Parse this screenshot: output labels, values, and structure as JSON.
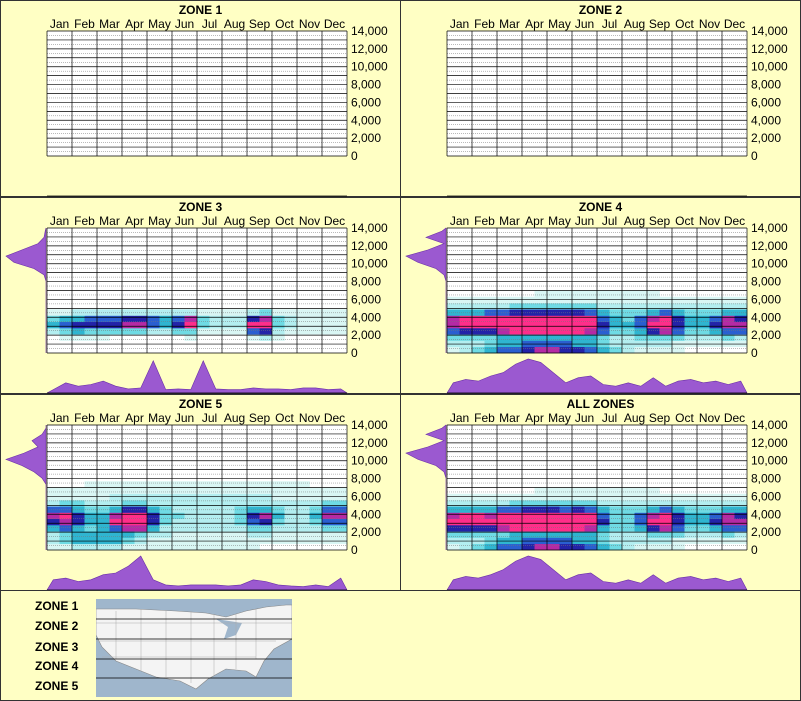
{
  "months": [
    "Jan",
    "Feb",
    "Mar",
    "Apr",
    "May",
    "Jun",
    "Jul",
    "Aug",
    "Sep",
    "Oct",
    "Nov",
    "Dec"
  ],
  "y_ticks": [
    "14,000",
    "12,000",
    "10,000",
    "8,000",
    "6,000",
    "4,000",
    "2,000",
    "0"
  ],
  "colors": {
    "background": "#ffffc4",
    "profile": "#9b59d0",
    "low": "#c8f0f0",
    "mid": "#3ec6d6",
    "high": "#1a1aa8",
    "peak": "#ff2e8a"
  },
  "legend": {
    "zones": [
      "ZONE 1",
      "ZONE 2",
      "ZONE 3",
      "ZONE 4",
      "ZONE 5"
    ]
  },
  "chart_data": [
    {
      "type": "heatmap",
      "title": "ZONE 1",
      "x": [
        "Jan",
        "Feb",
        "Mar",
        "Apr",
        "May",
        "Jun",
        "Jul",
        "Aug",
        "Sep",
        "Oct",
        "Nov",
        "Dec"
      ],
      "ylim": [
        0,
        14000
      ],
      "blobs": [],
      "monthly_profile": [],
      "elevation_profile": []
    },
    {
      "type": "heatmap",
      "title": "ZONE 2",
      "x": [
        "Jan",
        "Feb",
        "Mar",
        "Apr",
        "May",
        "Jun",
        "Jul",
        "Aug",
        "Sep",
        "Oct",
        "Nov",
        "Dec"
      ],
      "ylim": [
        0,
        14000
      ],
      "blobs": [],
      "monthly_profile": [],
      "elevation_profile": []
    },
    {
      "type": "heatmap",
      "title": "ZONE 3",
      "x": [
        "Jan",
        "Feb",
        "Mar",
        "Apr",
        "May",
        "Jun",
        "Jul",
        "Aug",
        "Sep",
        "Oct",
        "Nov",
        "Dec"
      ],
      "ylim": [
        0,
        14000
      ],
      "blobs": [
        {
          "month": 1.2,
          "elev": 3200,
          "sm": 0.9,
          "se": 700,
          "w": 0.7
        },
        {
          "month": 3.5,
          "elev": 3400,
          "sm": 0.9,
          "se": 600,
          "w": 0.8
        },
        {
          "month": 5.6,
          "elev": 3400,
          "sm": 0.3,
          "se": 600,
          "w": 1.0
        },
        {
          "month": 8.6,
          "elev": 3200,
          "sm": 0.35,
          "se": 700,
          "w": 1.4
        },
        {
          "month": 6.5,
          "elev": 3500,
          "sm": 4.5,
          "se": 1000,
          "w": 0.25
        }
      ],
      "monthly_profile": [
        0.1,
        0.3,
        0.2,
        0.25,
        0.35,
        0.2,
        0.12,
        0.15,
        0.95,
        0.1,
        0.12,
        0.1,
        0.95,
        0.12,
        0.1,
        0.1,
        0.15,
        0.12,
        0.12,
        0.1,
        0.15,
        0.15,
        0.1,
        0.12
      ],
      "elevation_profile": [
        0,
        0,
        0,
        0,
        0,
        0,
        0,
        0,
        0,
        0,
        0,
        0,
        0.05,
        0.3,
        0.8,
        1.0,
        0.6,
        0.2,
        0.05,
        0.02
      ]
    },
    {
      "type": "heatmap",
      "title": "ZONE 4",
      "x": [
        "Jan",
        "Feb",
        "Mar",
        "Apr",
        "May",
        "Jun",
        "Jul",
        "Aug",
        "Sep",
        "Oct",
        "Nov",
        "Dec"
      ],
      "ylim": [
        0,
        14000
      ],
      "blobs": [
        {
          "month": 3.5,
          "elev": 3300,
          "sm": 1.4,
          "se": 900,
          "w": 1.5
        },
        {
          "month": 0.6,
          "elev": 3300,
          "sm": 0.8,
          "se": 900,
          "w": 0.8
        },
        {
          "month": 5.5,
          "elev": 3300,
          "sm": 0.5,
          "se": 900,
          "w": 0.8
        },
        {
          "month": 8.6,
          "elev": 3300,
          "sm": 0.6,
          "se": 900,
          "w": 1.0
        },
        {
          "month": 11.4,
          "elev": 3300,
          "sm": 0.7,
          "se": 900,
          "w": 0.8
        },
        {
          "month": 4.0,
          "elev": 500,
          "sm": 1.8,
          "se": 500,
          "w": 0.9
        },
        {
          "month": 6.0,
          "elev": 3500,
          "sm": 6.0,
          "se": 1800,
          "w": 0.35
        }
      ],
      "monthly_profile": [
        0.3,
        0.4,
        0.35,
        0.5,
        0.6,
        0.85,
        1.0,
        0.9,
        0.6,
        0.3,
        0.45,
        0.5,
        0.25,
        0.2,
        0.3,
        0.2,
        0.45,
        0.2,
        0.35,
        0.4,
        0.3,
        0.35,
        0.25,
        0.35
      ],
      "elevation_profile": [
        0,
        0,
        0,
        0,
        0,
        0,
        0,
        0,
        0,
        0,
        0,
        0,
        0.05,
        0.25,
        0.7,
        1.0,
        0.45,
        0.05,
        0.5,
        0.1
      ]
    },
    {
      "type": "heatmap",
      "title": "ZONE 5",
      "x": [
        "Jan",
        "Feb",
        "Mar",
        "Apr",
        "May",
        "Jun",
        "Jul",
        "Aug",
        "Sep",
        "Oct",
        "Nov",
        "Dec"
      ],
      "ylim": [
        0,
        14000
      ],
      "blobs": [
        {
          "month": 3.4,
          "elev": 3400,
          "sm": 0.6,
          "se": 800,
          "w": 1.6
        },
        {
          "month": 0.7,
          "elev": 3600,
          "sm": 0.7,
          "se": 900,
          "w": 0.9
        },
        {
          "month": 8.6,
          "elev": 3600,
          "sm": 0.4,
          "se": 700,
          "w": 0.8
        },
        {
          "month": 11.5,
          "elev": 3800,
          "sm": 0.5,
          "se": 900,
          "w": 0.8
        },
        {
          "month": 2.0,
          "elev": 1200,
          "sm": 1.0,
          "se": 700,
          "w": 0.5
        },
        {
          "month": 6.0,
          "elev": 4000,
          "sm": 6.0,
          "se": 2200,
          "w": 0.3
        }
      ],
      "monthly_profile": [
        0.3,
        0.35,
        0.25,
        0.3,
        0.45,
        0.5,
        0.7,
        1.0,
        0.3,
        0.15,
        0.12,
        0.15,
        0.15,
        0.15,
        0.12,
        0.15,
        0.3,
        0.25,
        0.15,
        0.12,
        0.1,
        0.15,
        0.1,
        0.35
      ],
      "elevation_profile": [
        0,
        0,
        0,
        0,
        0,
        0,
        0,
        0,
        0,
        0,
        0,
        0.1,
        0.3,
        0.6,
        1.0,
        0.55,
        0.2,
        0.35,
        0.1,
        0
      ]
    },
    {
      "type": "heatmap",
      "title": "ALL ZONES",
      "x": [
        "Jan",
        "Feb",
        "Mar",
        "Apr",
        "May",
        "Jun",
        "Jul",
        "Aug",
        "Sep",
        "Oct",
        "Nov",
        "Dec"
      ],
      "ylim": [
        0,
        14000
      ],
      "blobs": [
        {
          "month": 3.5,
          "elev": 3300,
          "sm": 1.3,
          "se": 900,
          "w": 1.5
        },
        {
          "month": 0.6,
          "elev": 3300,
          "sm": 0.8,
          "se": 900,
          "w": 0.9
        },
        {
          "month": 5.5,
          "elev": 3300,
          "sm": 0.5,
          "se": 900,
          "w": 0.8
        },
        {
          "month": 8.6,
          "elev": 3300,
          "sm": 0.6,
          "se": 900,
          "w": 1.0
        },
        {
          "month": 11.4,
          "elev": 3300,
          "sm": 0.7,
          "se": 900,
          "w": 0.8
        },
        {
          "month": 4.0,
          "elev": 500,
          "sm": 1.8,
          "se": 500,
          "w": 0.9
        },
        {
          "month": 6.0,
          "elev": 3500,
          "sm": 6.0,
          "se": 1800,
          "w": 0.35
        }
      ],
      "monthly_profile": [
        0.3,
        0.4,
        0.35,
        0.45,
        0.6,
        0.85,
        1.0,
        0.9,
        0.6,
        0.3,
        0.45,
        0.5,
        0.25,
        0.2,
        0.3,
        0.2,
        0.45,
        0.2,
        0.35,
        0.4,
        0.3,
        0.35,
        0.25,
        0.35
      ],
      "elevation_profile": [
        0,
        0,
        0,
        0,
        0,
        0,
        0,
        0,
        0,
        0,
        0,
        0,
        0.05,
        0.25,
        0.7,
        1.0,
        0.45,
        0.05,
        0.5,
        0.1
      ]
    }
  ]
}
